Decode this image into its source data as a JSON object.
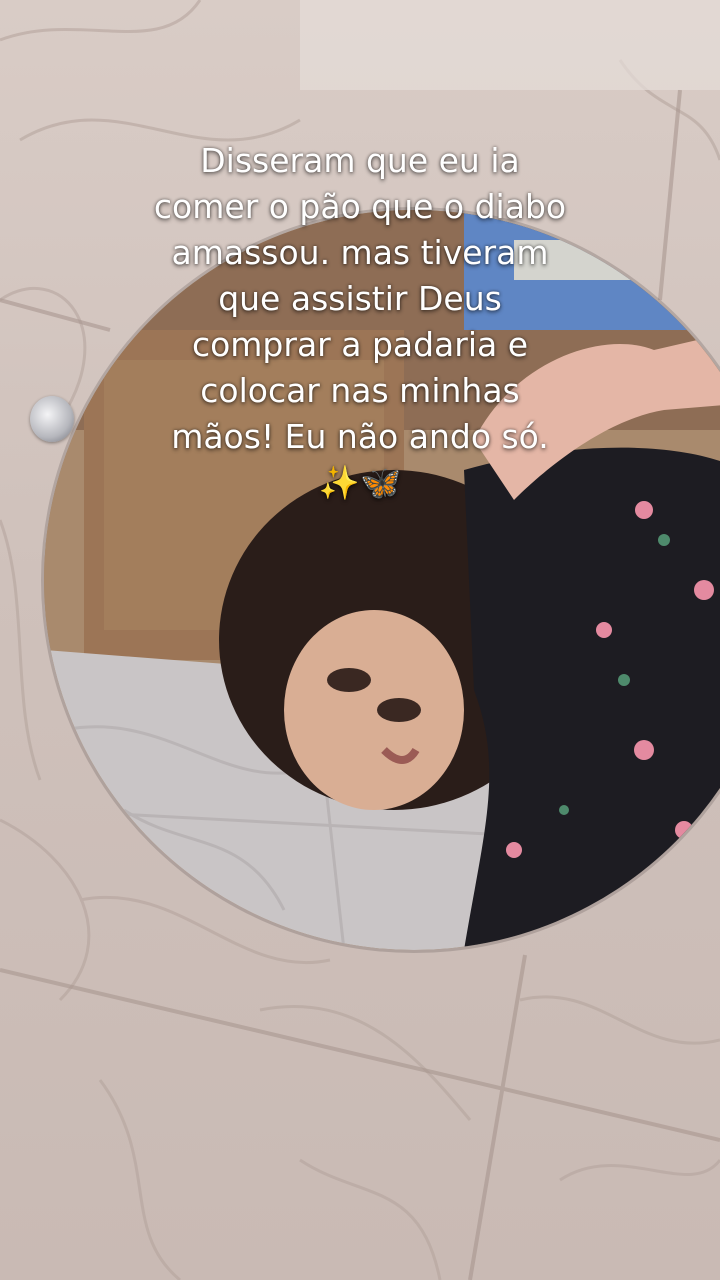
{
  "caption": {
    "lines": [
      "Disseram que eu ia",
      "comer o pão que o diabo",
      "amassou. mas tiveram",
      "que assistir Deus",
      "comprar a padaria e",
      "colocar nas minhas",
      "mãos! Eu não ando só.",
      "✨🦋"
    ]
  }
}
